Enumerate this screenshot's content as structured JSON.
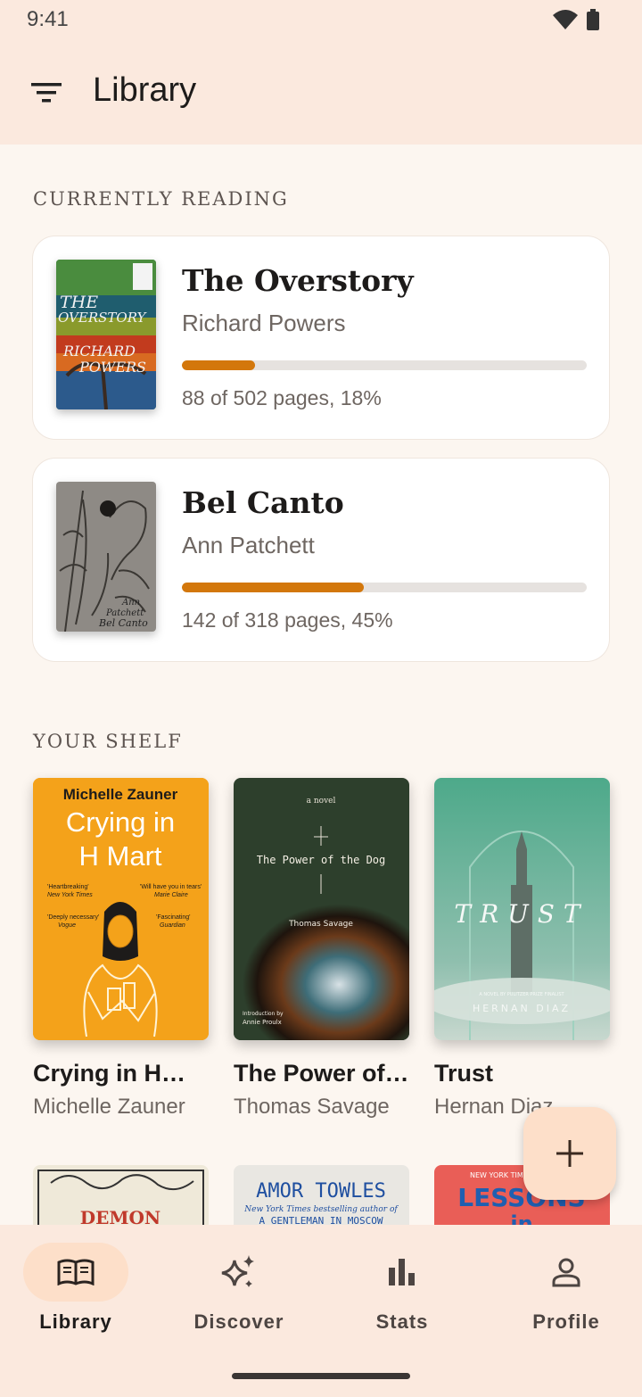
{
  "status": {
    "time": "9:41"
  },
  "app_bar": {
    "title": "Library"
  },
  "sections": {
    "currently_reading": "CURRENTLY READING",
    "your_shelf": "YOUR SHELF"
  },
  "currently_reading": [
    {
      "title": "The Overstory",
      "author": "Richard Powers",
      "progress": 0.18,
      "progress_text": "88 of 502 pages, 18%",
      "cover_text": [
        "THE",
        "OVERSTORY",
        "RICHARD",
        "POWERS"
      ]
    },
    {
      "title": "Bel Canto",
      "author": "Ann Patchett",
      "progress": 0.45,
      "progress_text": "142 of 318 pages, 45%",
      "cover_text": [
        "Ann",
        "Patchett",
        "Bel Canto"
      ]
    }
  ],
  "shelf": [
    {
      "title": "Crying in H…",
      "author": "Michelle Zauner",
      "cover": {
        "author": "Michelle Zauner",
        "title": "Crying in H Mart",
        "q1": "'Heartbreaking'",
        "s1": "New York Times",
        "q2": "'Will have you in tears'",
        "s2": "Marie Claire",
        "q3": "'Deeply necessary'",
        "s3": "Vogue",
        "q4": "'Fascinating'",
        "s4": "Guardian"
      }
    },
    {
      "title": "The Power of…",
      "author": "Thomas Savage",
      "cover": {
        "tag": "a novel",
        "title": "The Power of the Dog",
        "author": "Thomas Savage",
        "intro": "Introduction by",
        "intro_name": "Annie Proulx"
      }
    },
    {
      "title": "Trust",
      "author": "Hernan Diaz",
      "cover": {
        "title": "TRUST",
        "tag": "A NOVEL BY PULITZER PRIZE FINALIST",
        "author": "HERNAN DIAZ"
      }
    }
  ],
  "shelf_row2": [
    {
      "cover_text": "DEMON"
    },
    {
      "cover_text": "AMOR TOWLES",
      "cover_sub": "New York Times bestselling author of",
      "cover_sub2": "A GENTLEMAN IN MOSCOW"
    },
    {
      "cover_text": "LESSONS",
      "cover_tag": "NEW YORK TIMES"
    }
  ],
  "nav": [
    {
      "label": "Library",
      "icon": "book-open-icon",
      "active": true
    },
    {
      "label": "Discover",
      "icon": "sparkle-icon",
      "active": false
    },
    {
      "label": "Stats",
      "icon": "bar-chart-icon",
      "active": false
    },
    {
      "label": "Profile",
      "icon": "person-icon",
      "active": false
    }
  ],
  "colors": {
    "accent": "#d3770b",
    "surface": "#fbe9de",
    "fab": "#fddfc9"
  }
}
